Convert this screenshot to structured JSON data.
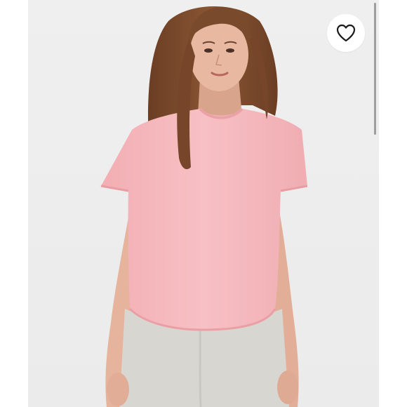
{
  "product_image": {
    "alt": "",
    "colors": {
      "backdrop": "#eeeeee",
      "shirt": "#f5b9bd",
      "skin": "#e6b39c",
      "hair": "#7a4a2c",
      "pants": "#d8d6d1"
    }
  },
  "favorite": {
    "icon": "heart-outline-icon",
    "state": "unselected"
  },
  "scrollbar": {
    "visible": true
  }
}
